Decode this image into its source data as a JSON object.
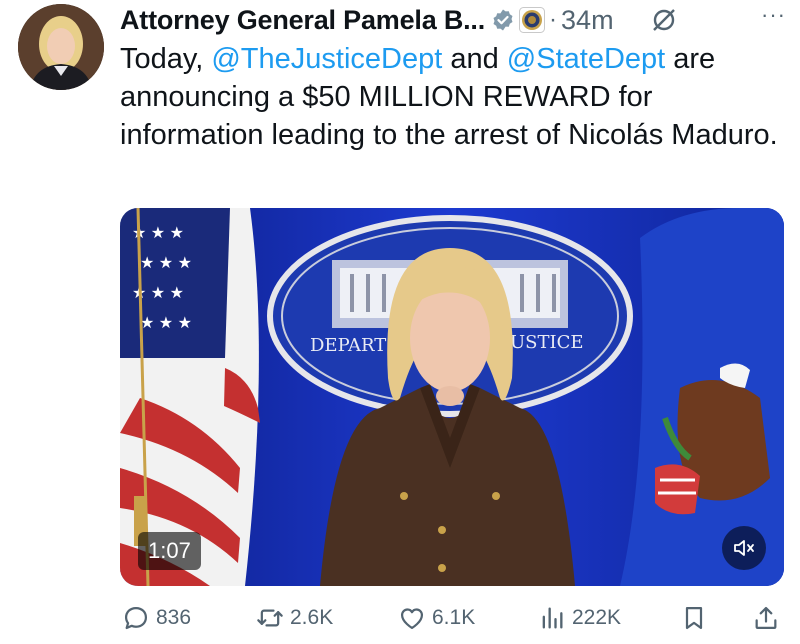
{
  "tweet": {
    "author_name": "Attorney General Pamela B...",
    "time": "34m",
    "dot": "·",
    "more": "···",
    "text_parts": {
      "p1": "Today, ",
      "mention1": "@TheJusticeDept",
      "p2": " and ",
      "mention2": "@StateDept",
      "p3": " are announcing a $50 MILLION REWARD for information leading to the arrest of Nicolás Maduro."
    }
  },
  "media": {
    "duration": "1:07",
    "seal_text_left": "DEPART",
    "seal_text_right": "USTICE"
  },
  "actions": {
    "replies": "836",
    "reposts": "2.6K",
    "likes": "6.1K",
    "views": "222K"
  },
  "colors": {
    "link": "#1d9bf0",
    "text": "#0f1419",
    "muted": "#536471",
    "backdrop_blue": "#1530a8"
  },
  "icons": [
    "verified-badge-icon",
    "doj-affiliation-icon",
    "grok-icon",
    "more-icon",
    "mute-icon",
    "reply-icon",
    "repost-icon",
    "like-icon",
    "views-icon",
    "bookmark-icon",
    "share-icon"
  ]
}
